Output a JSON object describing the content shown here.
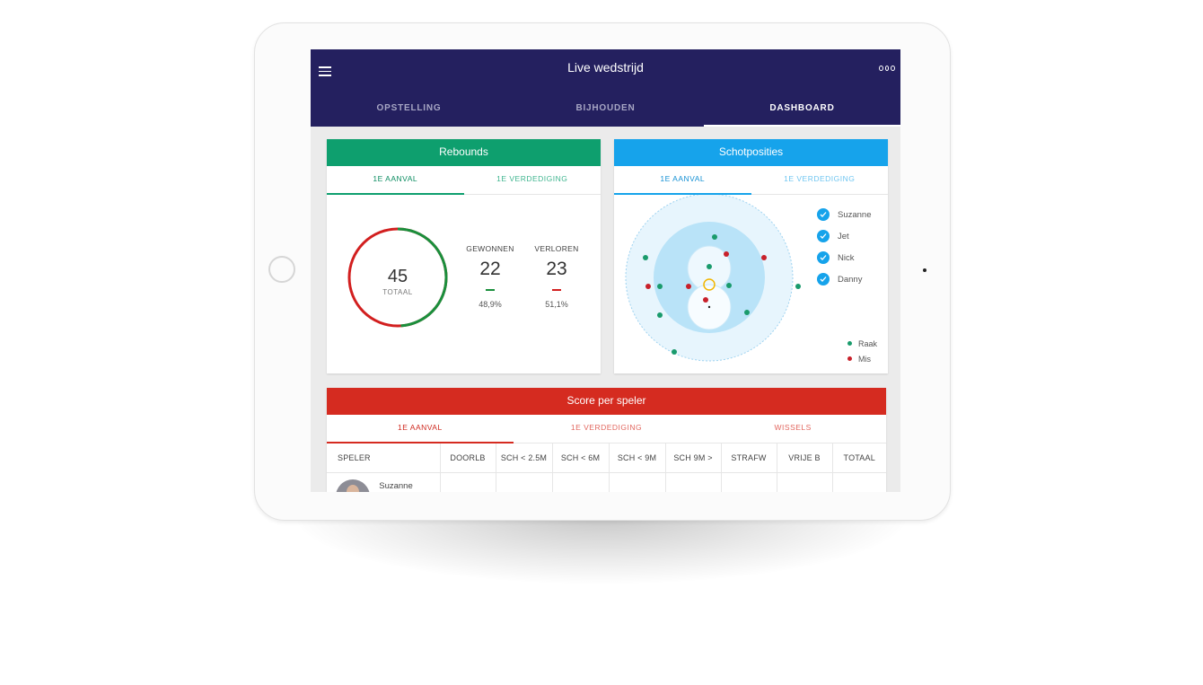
{
  "app": {
    "title": "Live wedstrijd"
  },
  "tabs": [
    "OPSTELLING",
    "BIJHOUDEN",
    "DASHBOARD"
  ],
  "rebounds": {
    "title": "Rebounds",
    "subtabs": [
      "1E AANVAL",
      "1E VERDEDIGING"
    ],
    "total": "45",
    "total_label": "TOTAAL",
    "won_label": "GEWONNEN",
    "won": "22",
    "won_pct": "48,9%",
    "lost_label": "VERLOREN",
    "lost": "23",
    "lost_pct": "51,1%",
    "won_fraction": 0.489,
    "colors": {
      "won": "#1a8f3c",
      "lost": "#d21f1f"
    }
  },
  "schot": {
    "title": "Schotposities",
    "subtabs": [
      "1E AANVAL",
      "1E VERDEDIGING"
    ],
    "players": [
      "Suzanne",
      "Jet",
      "Nick",
      "Danny"
    ],
    "legend": [
      "Raak",
      "Mis"
    ],
    "colors": {
      "raak": "#1a9b6c",
      "mis": "#c8202a"
    }
  },
  "score": {
    "title": "Score per speler",
    "subtabs": [
      "1E AANVAL",
      "1E VERDEDIGING",
      "WISSELS"
    ],
    "columns": [
      "SPELER",
      "DOORLB",
      "SCH < 2.5M",
      "SCH < 6M",
      "SCH < 9M",
      "SCH 9M >",
      "STRAFW",
      "VRIJE B",
      "TOTAAL"
    ],
    "rows": [
      {
        "player": "Suzanne"
      }
    ]
  }
}
